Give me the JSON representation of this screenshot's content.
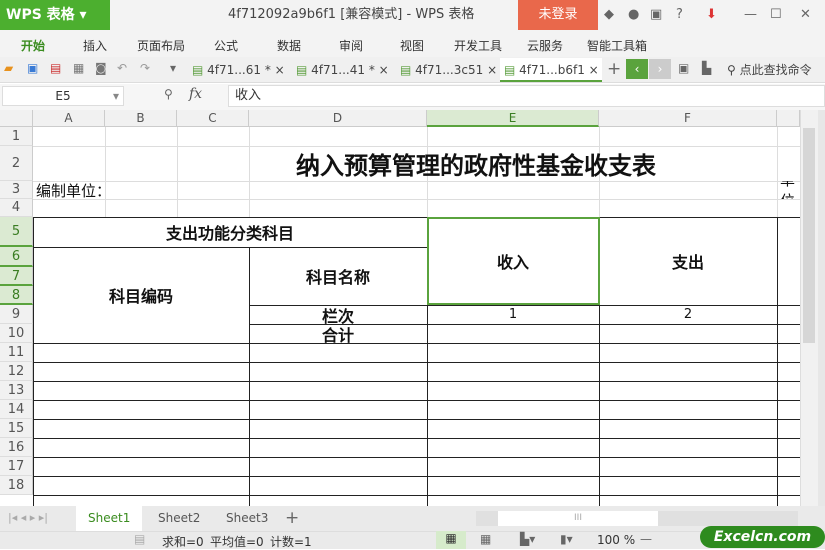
{
  "app": {
    "logo": "WPS 表格",
    "title": "4f712092a9b6f1 [兼容模式] - WPS 表格",
    "login": "未登录",
    "help": "?"
  },
  "menu": [
    "开始",
    "插入",
    "页面布局",
    "公式",
    "数据",
    "审阅",
    "视图",
    "开发工具",
    "云服务",
    "智能工具箱"
  ],
  "doc_tabs": [
    {
      "label": "4f71...61 *"
    },
    {
      "label": "4f71...41 *"
    },
    {
      "label": "4f71...3c51"
    },
    {
      "label": "4f71...b6f1",
      "active": true
    }
  ],
  "search_cmd": "点此查找命令",
  "formula_bar": {
    "name_box": "E5",
    "fx": "fx",
    "value": "收入"
  },
  "columns": [
    "A",
    "B",
    "C",
    "D",
    "E",
    "F"
  ],
  "rows": [
    "1",
    "2",
    "3",
    "4",
    "5",
    "6",
    "7",
    "8",
    "9",
    "10",
    "11",
    "12",
    "13",
    "14",
    "15",
    "16",
    "17",
    "18"
  ],
  "sheet": {
    "title": "纳入预算管理的政府性基金收支表",
    "compiler": "编制单位：",
    "unit": "单位",
    "h_func": "支出功能分类科目",
    "h_code": "科目编码",
    "h_name": "科目名称",
    "h_income": "收入",
    "h_expense": "支出",
    "lanci": "栏次",
    "heji": "合计",
    "n1": "1",
    "n2": "2"
  },
  "sheet_tabs": [
    "Sheet1",
    "Sheet2",
    "Sheet3"
  ],
  "status": {
    "sum": "求和=0",
    "avg": "平均值=0",
    "count": "计数=1",
    "zoom": "100 %"
  },
  "watermark": "Excelcn.com"
}
